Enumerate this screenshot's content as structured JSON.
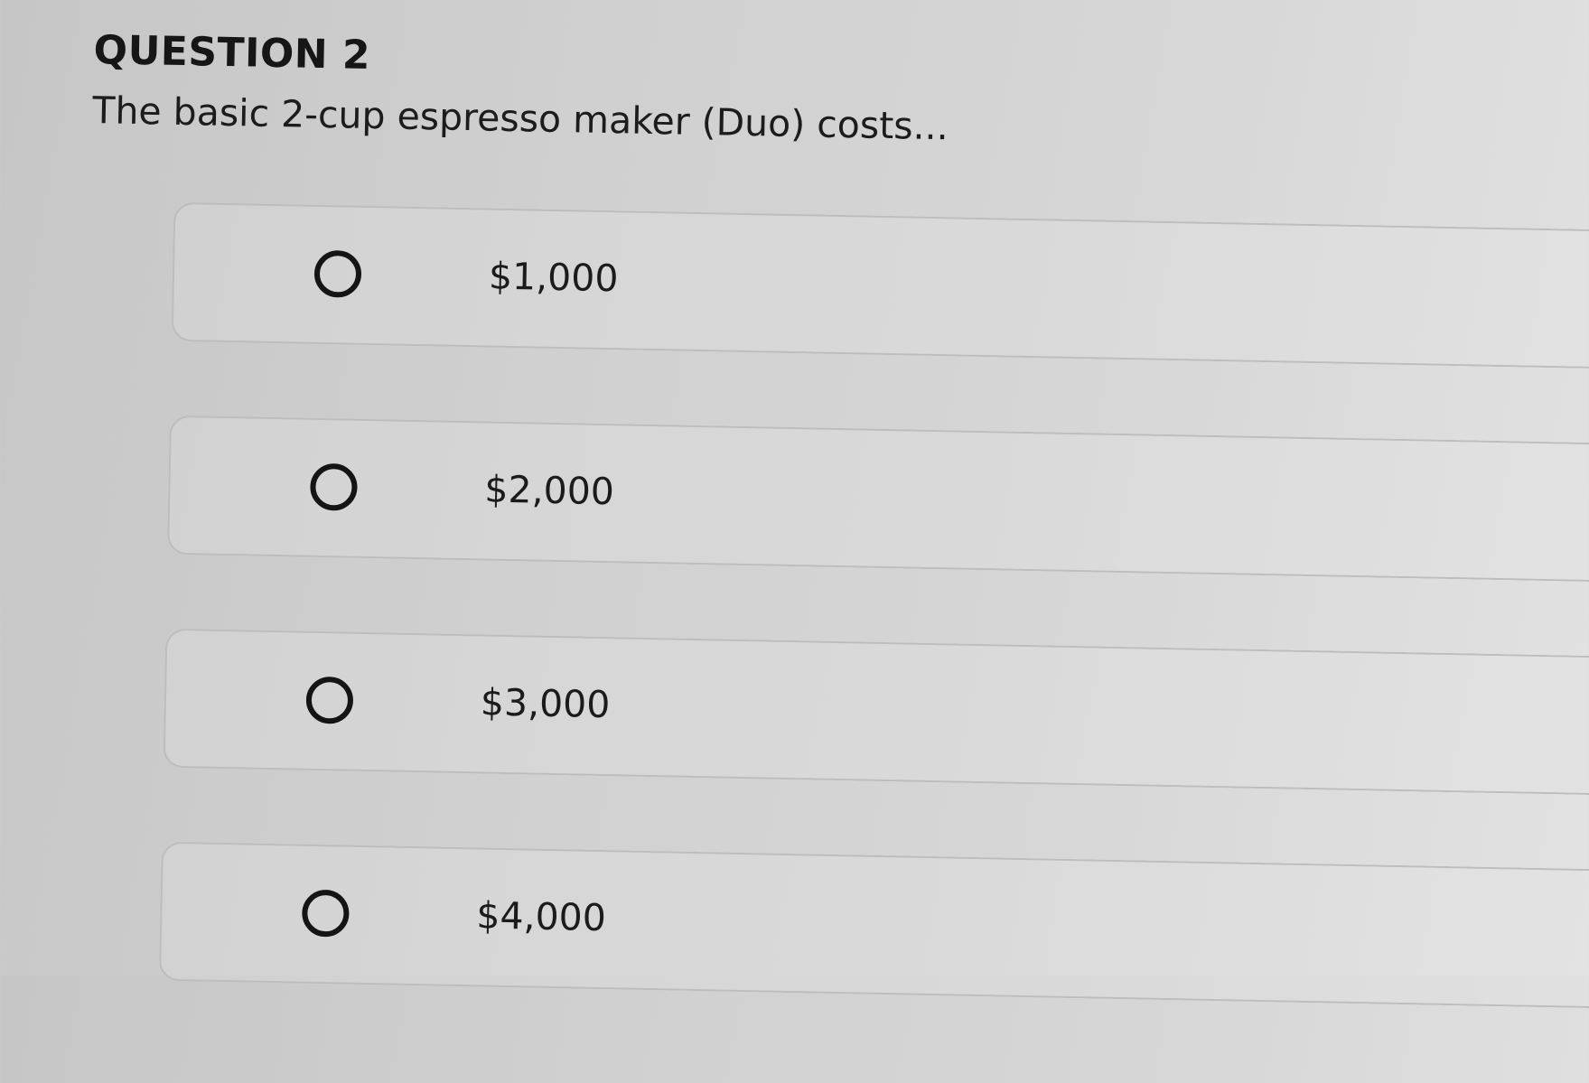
{
  "question": {
    "number_label": "QUESTION 2",
    "text": "The basic 2-cup espresso maker (Duo) costs..."
  },
  "options": [
    {
      "label": "$1,000"
    },
    {
      "label": "$2,000"
    },
    {
      "label": "$3,000"
    },
    {
      "label": "$4,000"
    }
  ]
}
